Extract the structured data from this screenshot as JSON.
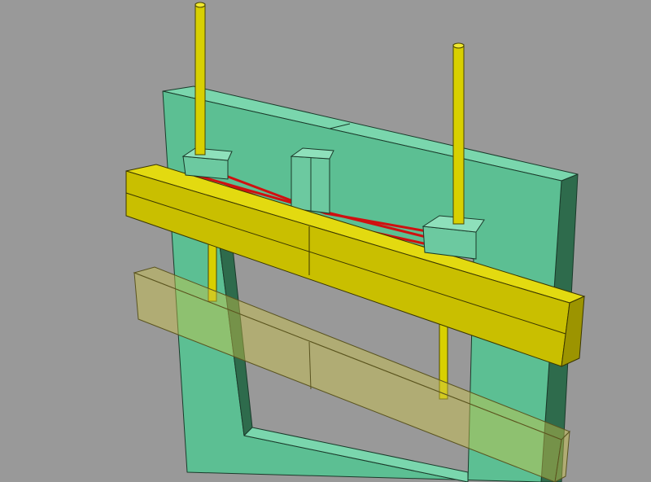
{
  "scene": {
    "background_color": "#999999",
    "frame_colors": {
      "front": "#5cbf93",
      "top": "#7ad6ad",
      "side": "#2e6b4c",
      "edge": "#1a3a2a"
    },
    "beam_colors": {
      "front": "#c9bf00",
      "top": "#e3da10",
      "end": "#9c9400",
      "edge": "#3a3600"
    },
    "ghost_beam_color": "rgba(205,195,70,0.45)",
    "rod_color": "#d8d000",
    "belt_color": "#d01010",
    "block_color": "#6cc9a0"
  }
}
